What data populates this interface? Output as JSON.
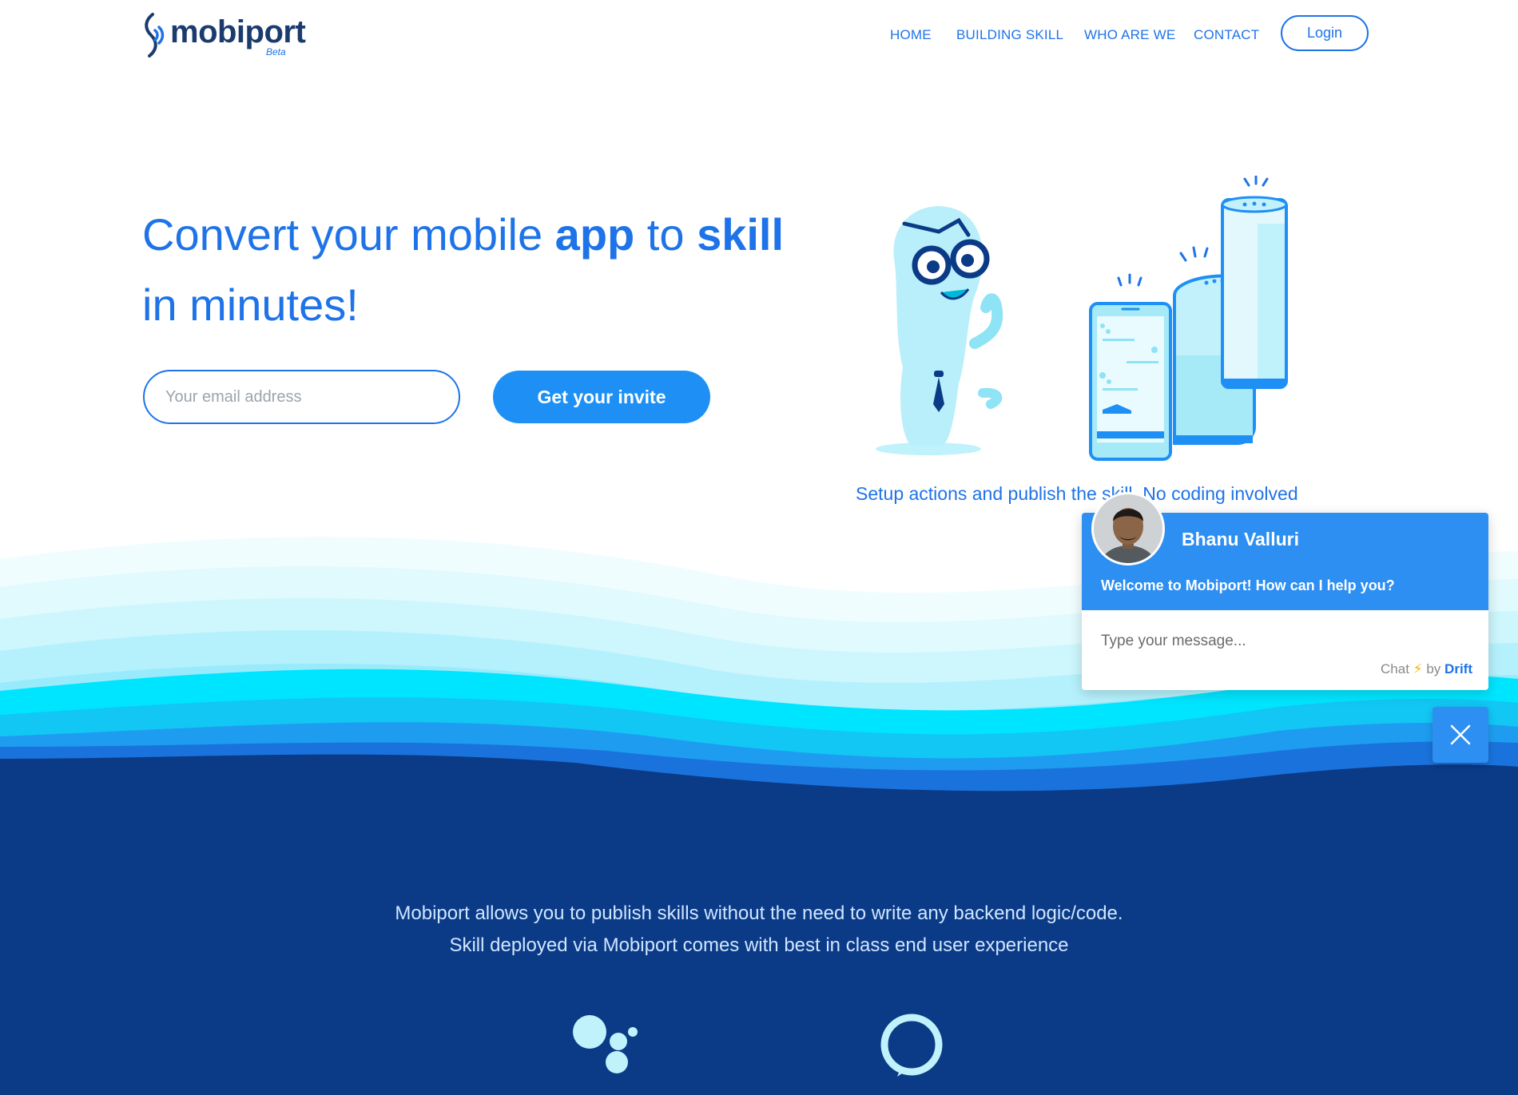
{
  "brand": {
    "name": "mobiport",
    "badge": "Beta"
  },
  "nav": {
    "items": [
      {
        "label": "HOME"
      },
      {
        "label": "BUILDING SKILL"
      },
      {
        "label": "WHO ARE WE"
      },
      {
        "label": "CONTACT"
      }
    ],
    "login_label": "Login"
  },
  "hero": {
    "title_part1": "Convert your mobile ",
    "title_bold1": "app",
    "title_part2": " to ",
    "title_bold2": "skill",
    "title_line2": "in minutes!",
    "email_placeholder": "Your email address",
    "cta_label": "Get your invite",
    "caption": "Setup actions and publish the skill. No coding involved"
  },
  "about": {
    "line1": "Mobiport allows you to publish skills without the need to write any backend logic/code.",
    "line2": "Skill deployed via Mobiport comes with best in class end user experience"
  },
  "platform_icons": [
    "google-assistant-icon",
    "alexa-icon"
  ],
  "chat": {
    "agent_name": "Bhanu Valluri",
    "welcome": "Welcome to Mobiport! How can I help you?",
    "input_placeholder": "Type your message...",
    "footer_chat": "Chat",
    "footer_by": "by",
    "footer_brand": "Drift"
  },
  "colors": {
    "brand_blue": "#1e73e8",
    "button_blue": "#1e90f5",
    "dark_navy": "#0b3a87",
    "cyan": "#00e5ff",
    "chat_blue": "#2d8ff2"
  }
}
